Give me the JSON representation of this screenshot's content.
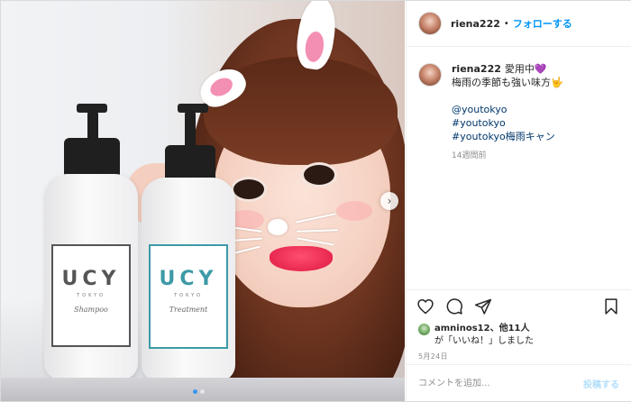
{
  "header": {
    "username": "riena222",
    "separator": "•",
    "follow_label": "フォローする"
  },
  "caption": {
    "username": "riena222",
    "line1": "愛用中💜",
    "line2": "梅雨の季節も強い味方🤟",
    "mention": "@youtokyo",
    "hashtag1": "#youtokyo",
    "hashtag2": "#youtokyo梅雨キャン",
    "time_ago": "14週間前"
  },
  "photo": {
    "bottle_left_brand": "UCY",
    "bottle_left_sub": "TOKYO",
    "bottle_left_script": "Shampoo",
    "bottle_right_brand": "UCY",
    "bottle_right_sub": "TOKYO",
    "bottle_right_script": "Treatment",
    "next_label": "›",
    "pagination_dots": 2,
    "active_dot": 0
  },
  "actions": {
    "icons": [
      "heart-icon",
      "comment-icon",
      "share-icon",
      "bookmark-icon"
    ]
  },
  "likes": {
    "liker": "amninos12",
    "others": "、他11人",
    "suffix": "が「いいね！」しました"
  },
  "date": "5月24日",
  "comment": {
    "placeholder": "コメントを追加...",
    "post_label": "投稿する"
  },
  "colors": {
    "link": "#0095f6",
    "hashtag": "#00376b",
    "post_disabled": "#b2dffc",
    "muted": "#8e8e8e"
  }
}
